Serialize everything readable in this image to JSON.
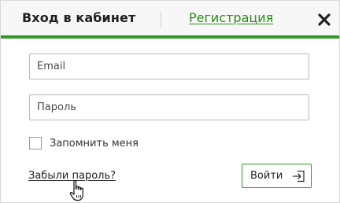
{
  "header": {
    "login_tab": "Вход в кабинет",
    "register_tab": "Регистрация",
    "close_icon": "close-icon"
  },
  "form": {
    "email_placeholder": "Email",
    "password_placeholder": "Пароль",
    "remember_label": "Запомнить меня",
    "remember_checked": false,
    "forgot_link": "Забыли пароль?",
    "submit_label": "Войти",
    "submit_icon": "sign-in-icon"
  },
  "colors": {
    "accent": "#2e9a22",
    "link": "#2a8f1a",
    "header_bg": "#f7f7f7"
  }
}
